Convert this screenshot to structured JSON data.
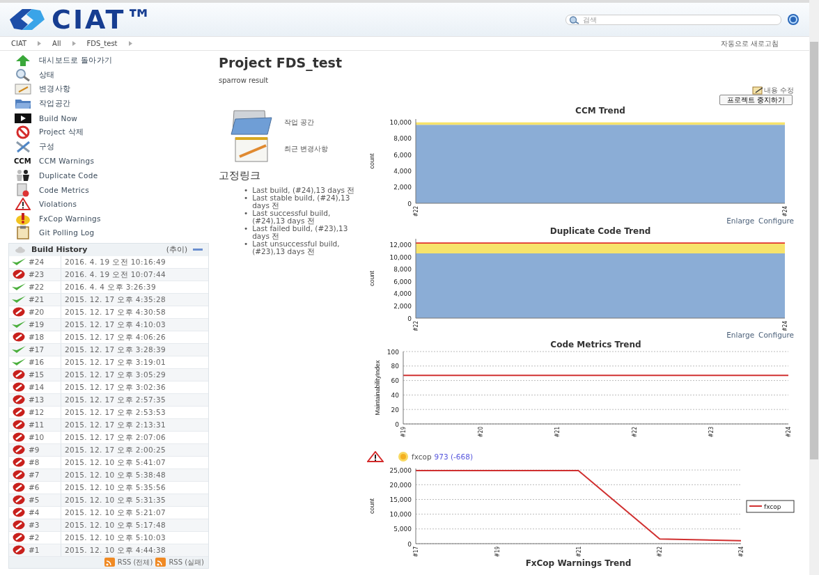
{
  "header": {
    "logo": "CIAT™",
    "search": {
      "placeholder": "검색"
    }
  },
  "breadcrumb": [
    {
      "label": "CIAT"
    },
    {
      "label": "All"
    },
    {
      "label": "FDS_test"
    }
  ],
  "auto_refresh": "자동으로 새로고침",
  "sidebar": {
    "items": [
      {
        "label": "대시보드로 돌아가기"
      },
      {
        "label": "상태"
      },
      {
        "label": "변경사항"
      },
      {
        "label": "작업공간"
      },
      {
        "label": "Build Now"
      },
      {
        "label": "Project 삭제"
      },
      {
        "label": "구성"
      },
      {
        "label": "CCM Warnings",
        "badge": "CCM"
      },
      {
        "label": "Duplicate Code"
      },
      {
        "label": "Code Metrics"
      },
      {
        "label": "Violations"
      },
      {
        "label": "FxCop Warnings"
      },
      {
        "label": "Git Polling Log"
      }
    ]
  },
  "build_history": {
    "title": "Build History",
    "trend_link": "(추이)",
    "rows": [
      {
        "number": "#24",
        "date": "2016. 4. 19 오전 10:16:49",
        "kind": "success"
      },
      {
        "number": "#23",
        "date": "2016. 4. 19 오전 10:07:44",
        "kind": "failure"
      },
      {
        "number": "#22",
        "date": "2016. 4. 4 오후 3:26:39",
        "kind": "success"
      },
      {
        "number": "#21",
        "date": "2015. 12. 17 오후 4:35:28",
        "kind": "success"
      },
      {
        "number": "#20",
        "date": "2015. 12. 17 오후 4:30:58",
        "kind": "failure"
      },
      {
        "number": "#19",
        "date": "2015. 12. 17 오후 4:10:03",
        "kind": "success"
      },
      {
        "number": "#18",
        "date": "2015. 12. 17 오후 4:06:26",
        "kind": "failure"
      },
      {
        "number": "#17",
        "date": "2015. 12. 17 오후 3:28:39",
        "kind": "success"
      },
      {
        "number": "#16",
        "date": "2015. 12. 17 오후 3:19:01",
        "kind": "success"
      },
      {
        "number": "#15",
        "date": "2015. 12. 17 오후 3:05:29",
        "kind": "failure"
      },
      {
        "number": "#14",
        "date": "2015. 12. 17 오후 3:02:36",
        "kind": "failure"
      },
      {
        "number": "#13",
        "date": "2015. 12. 17 오후 2:57:35",
        "kind": "failure"
      },
      {
        "number": "#12",
        "date": "2015. 12. 17 오후 2:53:53",
        "kind": "failure"
      },
      {
        "number": "#11",
        "date": "2015. 12. 17 오후 2:13:31",
        "kind": "failure"
      },
      {
        "number": "#10",
        "date": "2015. 12. 17 오후 2:07:06",
        "kind": "failure"
      },
      {
        "number": "#9",
        "date": "2015. 12. 17 오후 2:00:25",
        "kind": "failure"
      },
      {
        "number": "#8",
        "date": "2015. 12. 10 오후 5:41:07",
        "kind": "failure"
      },
      {
        "number": "#7",
        "date": "2015. 12. 10 오후 5:38:48",
        "kind": "failure"
      },
      {
        "number": "#6",
        "date": "2015. 12. 10 오후 5:35:56",
        "kind": "failure"
      },
      {
        "number": "#5",
        "date": "2015. 12. 10 오후 5:31:35",
        "kind": "failure"
      },
      {
        "number": "#4",
        "date": "2015. 12. 10 오후 5:21:07",
        "kind": "failure"
      },
      {
        "number": "#3",
        "date": "2015. 12. 10 오후 5:17:48",
        "kind": "failure"
      },
      {
        "number": "#2",
        "date": "2015. 12. 10 오후 5:10:03",
        "kind": "failure"
      },
      {
        "number": "#1",
        "date": "2015. 12. 10 오후 4:44:38",
        "kind": "failure"
      }
    ],
    "rss": [
      "RSS (전체)",
      "RSS (실패)"
    ]
  },
  "project": {
    "title": "Project FDS_test",
    "description": "sparrow result",
    "edit_link": "내용 수정",
    "disable_button": "프로젝트 중지하기",
    "shortcuts": [
      {
        "label": "작업 공간"
      },
      {
        "label": "최근 변경사항"
      }
    ],
    "permalinks_title": "고정링크",
    "permalinks": [
      {
        "bullet": "•",
        "label": "Last build, (#24),13 days 전"
      },
      {
        "bullet": "•",
        "label": "Last stable build, (#24),13 days 전"
      },
      {
        "bullet": "•",
        "label": "Last successful build, (#24),13 days 전"
      },
      {
        "bullet": "•",
        "label": "Last failed build, (#23),13 days 전"
      },
      {
        "bullet": "•",
        "label": "Last unsuccessful build, (#23),13 days 전"
      }
    ]
  },
  "trends": [
    {
      "chart_data": {
        "type": "area",
        "title": "CCM Trend",
        "ylabel": "count",
        "categories": [
          "#22",
          "#24"
        ],
        "stacked": true,
        "ylim": [
          0,
          10400
        ],
        "yticks": [
          {
            "value": 0,
            "label": "0"
          },
          {
            "value": 2000,
            "label": "2,000"
          },
          {
            "value": 4000,
            "label": "4,000"
          },
          {
            "value": 6000,
            "label": "6,000"
          },
          {
            "value": 8000,
            "label": "8,000"
          },
          {
            "value": 10000,
            "label": "10,000"
          }
        ],
        "series": [
          {
            "color": "#8badd6",
            "values": [
              9700,
              9700
            ]
          },
          {
            "color": "#f7e36b",
            "values": [
              300,
              300
            ]
          }
        ]
      },
      "links": [
        "Enlarge",
        "Configure"
      ]
    },
    {
      "chart_data": {
        "type": "area",
        "title": "Duplicate Code Trend",
        "ylabel": "count",
        "categories": [
          "#22",
          "#24"
        ],
        "stacked": true,
        "ylim": [
          0,
          13000
        ],
        "yticks": [
          {
            "value": 0,
            "label": "0"
          },
          {
            "value": 2000,
            "label": "2,000"
          },
          {
            "value": 4000,
            "label": "4,000"
          },
          {
            "value": 6000,
            "label": "6,000"
          },
          {
            "value": 8000,
            "label": "8,000"
          },
          {
            "value": 10000,
            "label": "10,000"
          },
          {
            "value": 12000,
            "label": "12,000"
          }
        ],
        "series": [
          {
            "color": "#8badd6",
            "values": [
              10600,
              10600
            ]
          },
          {
            "color": "#f7e36b",
            "values": [
              1600,
              1600
            ]
          },
          {
            "color": "#e0302a",
            "values": [
              200,
              200
            ]
          }
        ]
      },
      "links": [
        "Enlarge",
        "Configure"
      ]
    },
    {
      "chart_data": {
        "type": "line",
        "title": "Code Metrics Trend",
        "ylabel": "MaintainabilityIndex",
        "categories": [
          "#19",
          "#20",
          "#21",
          "#22",
          "#23",
          "#24"
        ],
        "ylim": [
          0,
          100
        ],
        "yticks": [
          0,
          20,
          40,
          60,
          80,
          100
        ],
        "grid": true,
        "series": [
          {
            "color": "#d03030",
            "values": [
              67,
              67,
              67,
              67,
              67,
              67
            ]
          }
        ]
      }
    },
    {
      "summary": {
        "name": "fxcop",
        "count": "973 (-668)"
      },
      "chart_data": {
        "type": "line",
        "title": "FxCop Warnings Trend",
        "ylabel": "count",
        "categories": [
          "#17",
          "#19",
          "#21",
          "#22",
          "#24"
        ],
        "ylim": [
          0,
          25500
        ],
        "yticks": [
          {
            "value": 0,
            "label": "0"
          },
          {
            "value": 5000,
            "label": "5,000"
          },
          {
            "value": 10000,
            "label": "10,000"
          },
          {
            "value": 15000,
            "label": "15,000"
          },
          {
            "value": 20000,
            "label": "20,000"
          },
          {
            "value": 25000,
            "label": "25,000"
          }
        ],
        "grid": true,
        "series": [
          {
            "name": "fxcop",
            "color": "#d03030",
            "values": [
              24800,
              24800,
              24800,
              1600,
              1000
            ]
          }
        ]
      }
    }
  ]
}
